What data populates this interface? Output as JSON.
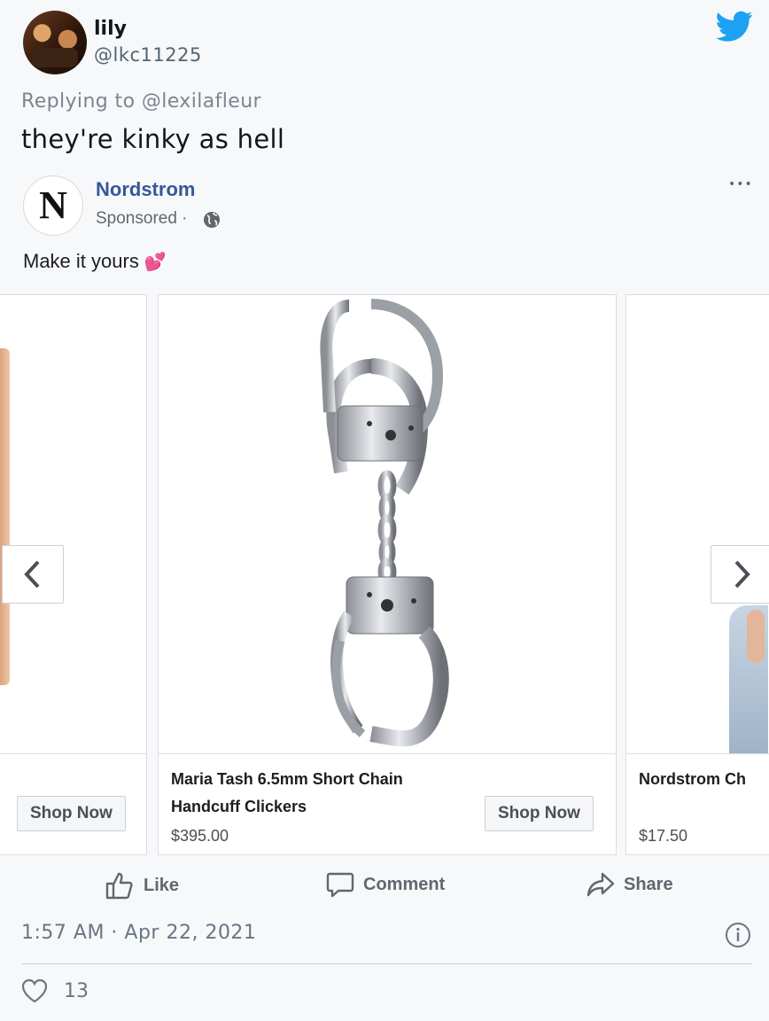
{
  "tweet": {
    "user_name": "lily",
    "user_handle": "@lkc11225",
    "replying_to": "Replying to @lexilafleur",
    "text": "they're kinky as hell",
    "timestamp": "1:57 AM · Apr 22, 2021",
    "like_count": "13"
  },
  "ad": {
    "brand_initial": "N",
    "brand_name": "Nordstrom",
    "sponsored_label": "Sponsored ·",
    "more_label": "•••",
    "caption": "Make it yours",
    "caption_emoji": "💕",
    "cards": [
      {
        "name": "",
        "price": "",
        "button": "Shop Now"
      },
      {
        "name_line1": "Maria Tash 6.5mm Short Chain",
        "name_line2": "Handcuff Clickers",
        "price": "$395.00",
        "button": "Shop Now"
      },
      {
        "name_line1": "Nordstrom Ch",
        "price": "$17.50"
      }
    ],
    "actions": {
      "like": "Like",
      "comment": "Comment",
      "share": "Share"
    }
  },
  "colors": {
    "brand_link": "#365899",
    "twitter_blue": "#1da1f2",
    "muted": "#687684"
  }
}
